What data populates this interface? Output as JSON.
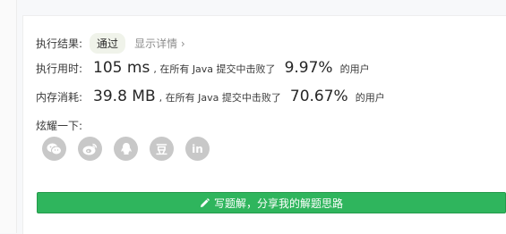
{
  "result": {
    "label": "执行结果:",
    "status": "通过",
    "details": "显示详情 ›"
  },
  "runtime": {
    "label": "执行用时:",
    "value": "105 ms",
    "beat_text": ", 在所有 Java 提交中击败了",
    "percent": "9.97%",
    "users_text": "的用户"
  },
  "memory": {
    "label": "内存消耗:",
    "value": "39.8 MB",
    "beat_text": ", 在所有 Java 提交中击败了",
    "percent": "70.67%",
    "users_text": "的用户"
  },
  "share": {
    "label": "炫耀一下:",
    "icons": [
      "wechat-icon",
      "weibo-icon",
      "qq-icon",
      "douban-icon",
      "linkedin-icon"
    ],
    "douban_glyph": "豆",
    "linkedin_glyph": "in"
  },
  "write_button": {
    "label": "写题解，分享我的解题思路",
    "icon": "pencil-icon"
  },
  "colors": {
    "accent_green": "#2fb55d",
    "icon_gray": "#c8c8c8"
  }
}
